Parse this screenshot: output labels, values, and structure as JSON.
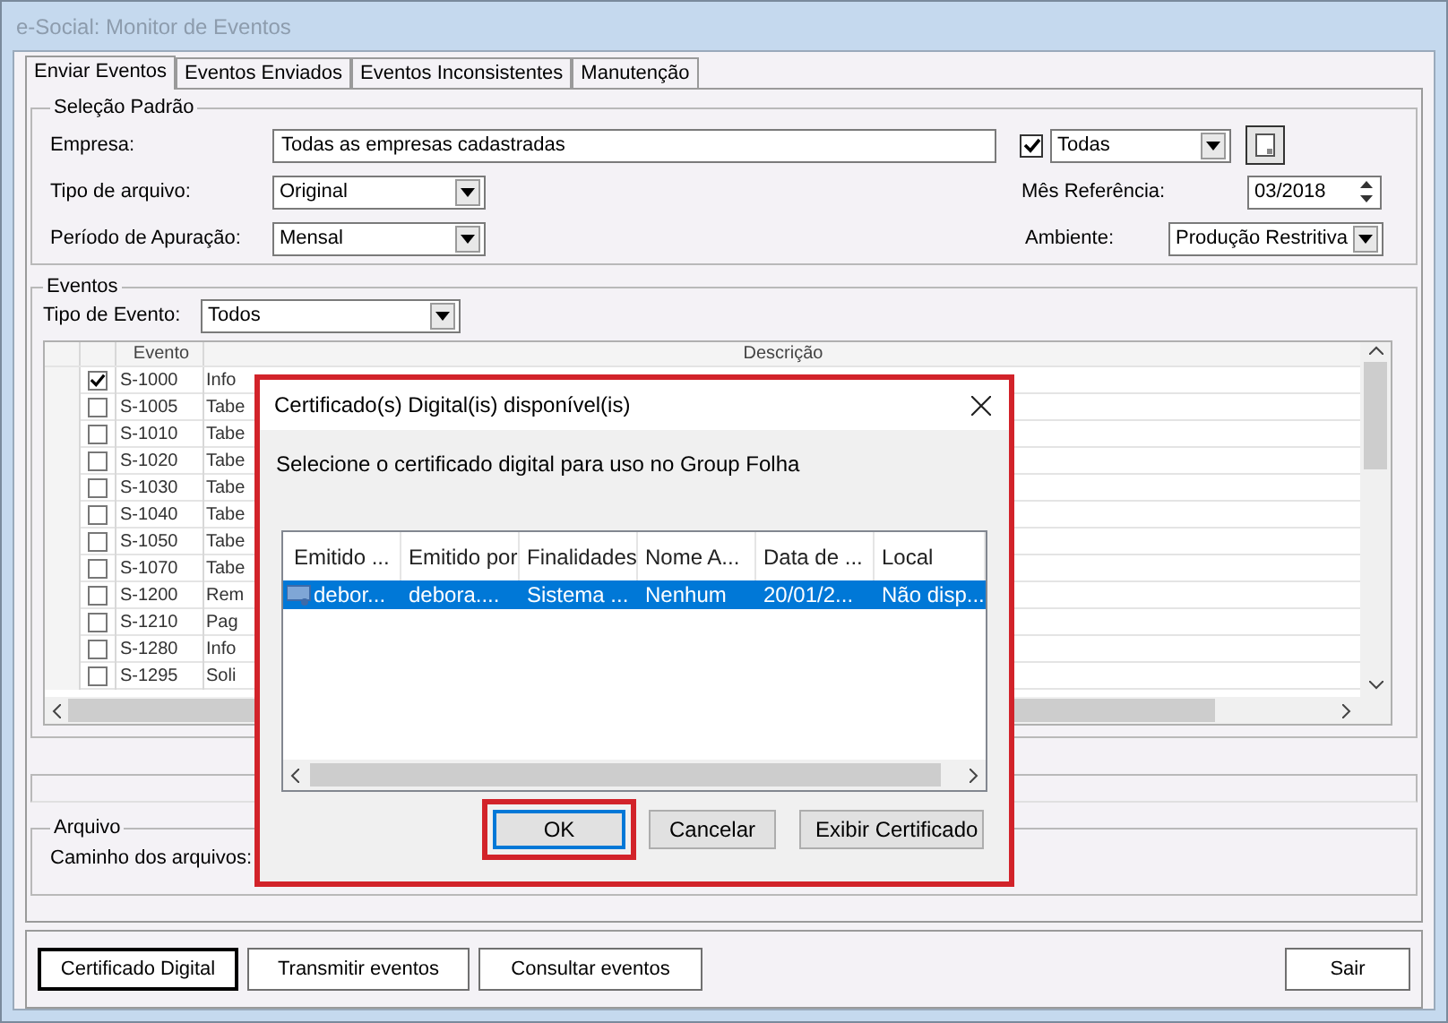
{
  "window": {
    "title": "e-Social: Monitor de Eventos"
  },
  "tabs": [
    {
      "label": "Enviar Eventos",
      "selected": true
    },
    {
      "label": "Eventos Enviados",
      "selected": false
    },
    {
      "label": "Eventos Inconsistentes",
      "selected": false
    },
    {
      "label": "Manutenção",
      "selected": false
    }
  ],
  "selecao_padrao": {
    "title": "Seleção Padrão",
    "empresa": {
      "label": "Empresa:",
      "value": "Todas as empresas cadastradas",
      "checked": true,
      "filter": "Todas"
    },
    "tipo_arquivo": {
      "label": "Tipo de arquivo:",
      "value": "Original"
    },
    "mes_referencia": {
      "label": "Mês Referência:",
      "value": "03/2018"
    },
    "periodo_apuracao": {
      "label": "Período de Apuração:",
      "value": "Mensal"
    },
    "ambiente": {
      "label": "Ambiente:",
      "value": "Produção Restritiva"
    }
  },
  "eventos": {
    "title": "Eventos",
    "tipo_evento": {
      "label": "Tipo de Evento:",
      "value": "Todos"
    },
    "columns": [
      "Evento",
      "Descrição"
    ],
    "rows": [
      {
        "checked": true,
        "evento": "S-1000",
        "descricao": "Info"
      },
      {
        "checked": false,
        "evento": "S-1005",
        "descricao": "Tabe"
      },
      {
        "checked": false,
        "evento": "S-1010",
        "descricao": "Tabe"
      },
      {
        "checked": false,
        "evento": "S-1020",
        "descricao": "Tabe"
      },
      {
        "checked": false,
        "evento": "S-1030",
        "descricao": "Tabe"
      },
      {
        "checked": false,
        "evento": "S-1040",
        "descricao": "Tabe"
      },
      {
        "checked": false,
        "evento": "S-1050",
        "descricao": "Tabe"
      },
      {
        "checked": false,
        "evento": "S-1070",
        "descricao": "Tabe"
      },
      {
        "checked": false,
        "evento": "S-1200",
        "descricao": "Rem"
      },
      {
        "checked": false,
        "evento": "S-1210",
        "descricao": "Pag"
      },
      {
        "checked": false,
        "evento": "S-1280",
        "descricao": "Info"
      },
      {
        "checked": false,
        "evento": "S-1295",
        "descricao": "Soli"
      }
    ]
  },
  "arquivo": {
    "title": "Arquivo",
    "label": "Caminho dos arquivos:"
  },
  "buttons": [
    {
      "label": "Certificado Digital",
      "default": true
    },
    {
      "label": "Transmitir eventos",
      "default": false
    },
    {
      "label": "Consultar eventos",
      "default": false
    },
    {
      "label": "Sair",
      "default": false
    }
  ],
  "dialog": {
    "title": "Certificado(s) Digital(is) disponível(is)",
    "message": "Selecione o certificado digital para uso no Group Folha",
    "columns": [
      "Emitido ...",
      "Emitido por",
      "Finalidades",
      "Nome A...",
      "Data de ...",
      "Local"
    ],
    "rows": [
      {
        "selected": true,
        "cells": [
          "debor...",
          "debora....",
          "Sistema ...",
          "Nenhum",
          "20/01/2...",
          "Não disp..."
        ]
      }
    ],
    "buttons": [
      {
        "label": "OK",
        "focused": true,
        "highlighted": true
      },
      {
        "label": "Cancelar",
        "focused": false,
        "highlighted": false
      },
      {
        "label": "Exibir Certificado",
        "focused": false,
        "highlighted": false
      }
    ]
  }
}
